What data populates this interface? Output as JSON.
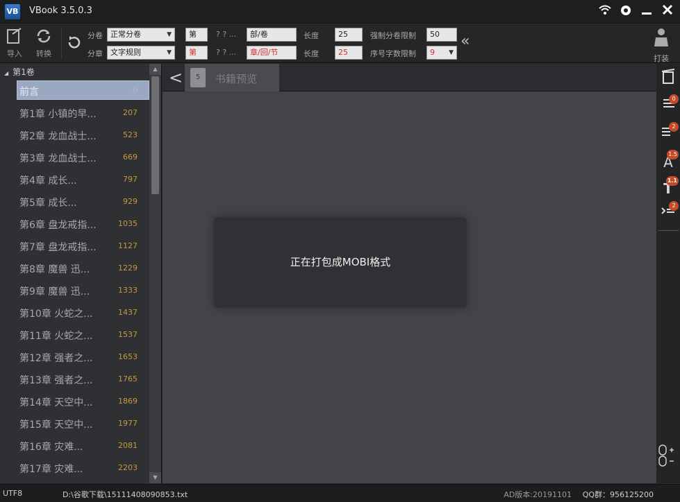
{
  "window": {
    "title": "VBook 3.5.0.3"
  },
  "toolbar": {
    "import_label": "导入",
    "convert_label": "转换",
    "volume_label": "分卷",
    "volume_mode": "正常分卷",
    "chapter_label": "分章",
    "chapter_mode": "文字规则",
    "vol_prefix": "第",
    "vol_placeholder": "? ? ...",
    "vol_suffix": "部/卷",
    "vol_length_label": "长度",
    "vol_length": "25",
    "force_vol_limit_label": "强制分卷限制",
    "force_vol_limit": "50",
    "ch_prefix": "第",
    "ch_placeholder": "? ? ...",
    "ch_suffix": "章/回/节",
    "ch_length_label": "长度",
    "ch_length": "25",
    "serial_limit_label": "序号字数限制",
    "serial_limit": "9",
    "pack_label": "打装"
  },
  "sidebar": {
    "root": "第1卷",
    "items": [
      {
        "name": "前言",
        "num": "0"
      },
      {
        "name": "第1章 小镇的早...",
        "num": "207"
      },
      {
        "name": "第2章 龙血战士...",
        "num": "523"
      },
      {
        "name": "第3章 龙血战士...",
        "num": "669"
      },
      {
        "name": "第4章 成长...",
        "num": "797"
      },
      {
        "name": "第5章 成长...",
        "num": "929"
      },
      {
        "name": "第6章 盘龙戒指...",
        "num": "1035"
      },
      {
        "name": "第7章 盘龙戒指...",
        "num": "1127"
      },
      {
        "name": "第8章 魔兽 迅...",
        "num": "1229"
      },
      {
        "name": "第9章 魔兽 迅...",
        "num": "1333"
      },
      {
        "name": "第10章 火蛇之...",
        "num": "1437"
      },
      {
        "name": "第11章 火蛇之...",
        "num": "1537"
      },
      {
        "name": "第12章 强者之...",
        "num": "1653"
      },
      {
        "name": "第13章 强者之...",
        "num": "1765"
      },
      {
        "name": "第14章 天空中...",
        "num": "1869"
      },
      {
        "name": "第15章 天空中...",
        "num": "1977"
      },
      {
        "name": "第16章 灾难...",
        "num": "2081"
      },
      {
        "name": "第17章 灾难...",
        "num": "2203"
      }
    ]
  },
  "main": {
    "tab_label": "书籍预览",
    "toast": "正在打包成MOBI格式"
  },
  "rightrail": {
    "badges": [
      "0",
      "2",
      "1.5",
      "1.1",
      "2"
    ]
  },
  "status": {
    "encoding": "UTF8",
    "path": "D:\\谷歌下载\\15111408090853.txt",
    "version": "AD版本:20191101",
    "qq": "QQ群：956125200"
  },
  "colors": {
    "accent_number": "#c79a3a",
    "selected_row": "#9aa8c2",
    "badge": "#c64a2a"
  }
}
